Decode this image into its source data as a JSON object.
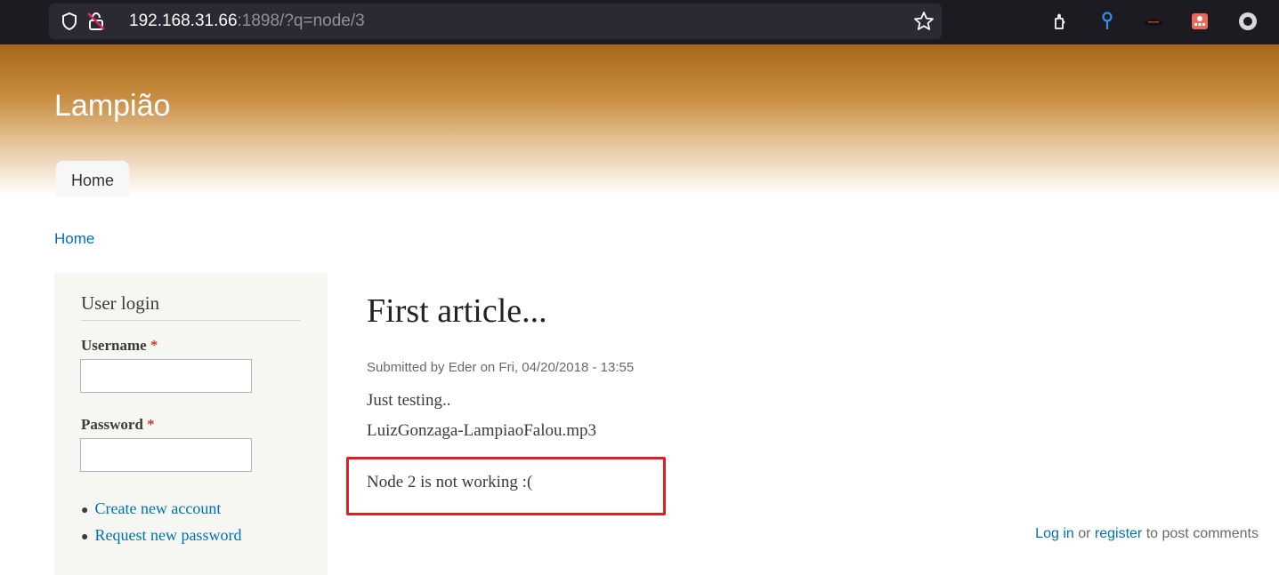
{
  "browser": {
    "url_host": "192.168.31.66",
    "url_rest": ":1898/?q=node/3",
    "icons": [
      "shield-icon",
      "insecure-lock-icon",
      "bookmark-star-icon",
      "extensions-icon",
      "pin-icon",
      "hat-icon",
      "addon-icon",
      "circle-icon"
    ]
  },
  "site": {
    "name": "Lampião",
    "nav": [
      {
        "label": "Home"
      }
    ]
  },
  "breadcrumb": {
    "home": "Home"
  },
  "sidebar": {
    "title": "User login",
    "username_label": "Username",
    "password_label": "Password",
    "required": "*",
    "username_value": "",
    "password_value": "",
    "links": [
      {
        "label": "Create new account"
      },
      {
        "label": "Request new password"
      }
    ]
  },
  "article": {
    "title": "First article...",
    "submitted": "Submitted by Eder on Fri, 04/20/2018 - 13:55",
    "body": [
      "Just testing..",
      "LuizGonzaga-LampiaoFalou.mp3",
      "Node 2 is not working :("
    ],
    "login_link": "Log in",
    "or_text": "or",
    "register_link": "register",
    "post_text": "to post comments"
  },
  "colors": {
    "accent_link": "#0071b3",
    "header_top": "#a8681a",
    "highlight": "#e02020",
    "required": "#cc0000"
  }
}
